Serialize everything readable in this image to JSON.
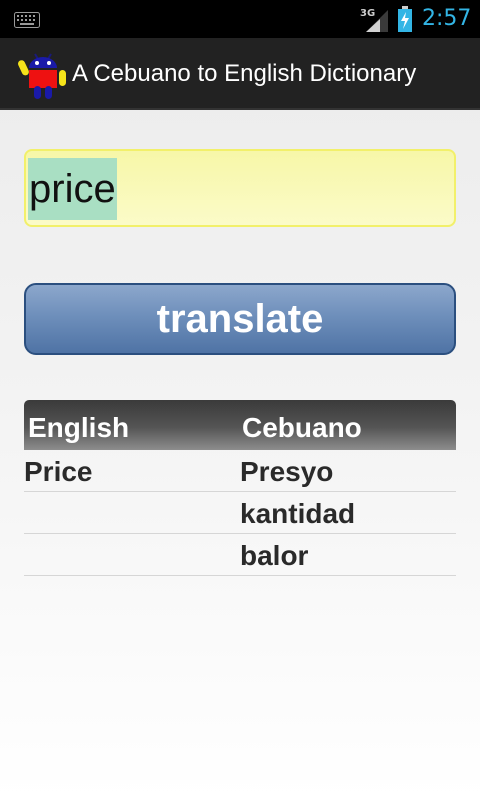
{
  "status_bar": {
    "network": "3G",
    "time": "2:57",
    "icons": [
      "keyboard-icon",
      "signal-icon",
      "battery-charging-icon"
    ]
  },
  "action_bar": {
    "title": "A Cebuano to English Dictionary",
    "icon": "android-app-icon"
  },
  "search": {
    "value": "price"
  },
  "translate_button": {
    "label": "translate"
  },
  "results": {
    "headers": {
      "english": "English",
      "cebuano": "Cebuano"
    },
    "rows": [
      {
        "english": "Price",
        "cebuano": "Presyo"
      },
      {
        "english": "",
        "cebuano": "kantidad"
      },
      {
        "english": "",
        "cebuano": "balor"
      }
    ]
  },
  "colors": {
    "clock": "#33b5e5",
    "input_background": "#fbfbc8",
    "input_border": "#f2f06a",
    "selection_highlight": "#a9dfc3",
    "button_gradient_top": "#8ca7cc",
    "button_gradient_bottom": "#4f73a5"
  }
}
